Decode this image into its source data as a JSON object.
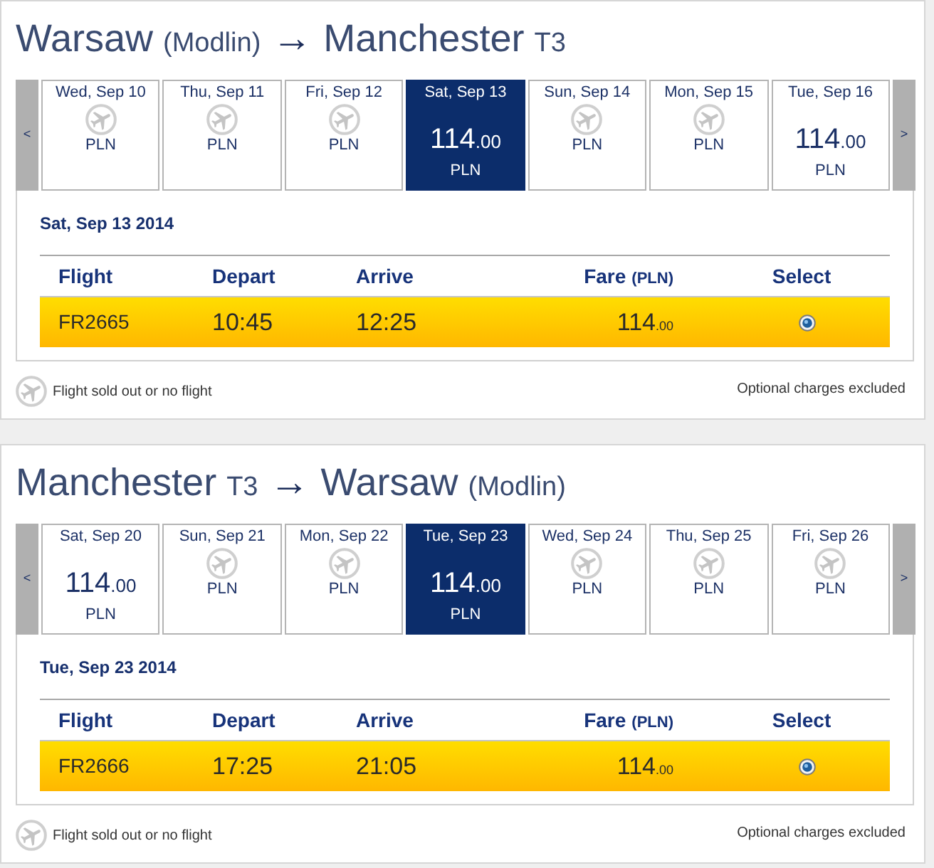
{
  "journeys": [
    {
      "title": {
        "origin": "Warsaw",
        "origin_note": "(Modlin)",
        "arrow": "→",
        "destination": "Manchester",
        "destination_note": "T3"
      },
      "prev_button": "<",
      "next_button": ">",
      "dates": [
        {
          "kind": "no_flight",
          "label": "Wed, Sep 10",
          "currency": "PLN",
          "selected": false
        },
        {
          "kind": "no_flight",
          "label": "Thu, Sep 11",
          "currency": "PLN",
          "selected": false
        },
        {
          "kind": "no_flight",
          "label": "Fri, Sep 12",
          "currency": "PLN",
          "selected": false
        },
        {
          "kind": "fare",
          "label": "Sat, Sep 13",
          "price": "114",
          "cents": ".00",
          "currency": "PLN",
          "selected": true
        },
        {
          "kind": "no_flight",
          "label": "Sun, Sep 14",
          "currency": "PLN",
          "selected": false
        },
        {
          "kind": "no_flight",
          "label": "Mon, Sep 15",
          "currency": "PLN",
          "selected": false
        },
        {
          "kind": "fare",
          "label": "Tue, Sep 16",
          "price": "114",
          "cents": ".00",
          "currency": "PLN",
          "selected": false
        }
      ],
      "selected_date": "Sat, Sep 13 2014",
      "columns": [
        {
          "label": "Flight"
        },
        {
          "label": "Depart"
        },
        {
          "label": "Arrive"
        },
        {
          "label": "Fare",
          "note": "(PLN)"
        },
        {
          "label": "Select"
        }
      ],
      "flights": [
        {
          "number": "FR2665",
          "depart": "10:45",
          "arrive": "12:25",
          "price": "114",
          "cents": ".00",
          "selected": true
        }
      ],
      "legend": "Flight sold out or no flight",
      "note": "Optional charges excluded"
    },
    {
      "title": {
        "origin": "Manchester",
        "origin_note": "T3",
        "arrow": "→",
        "destination": "Warsaw",
        "destination_note": "(Modlin)"
      },
      "prev_button": "<",
      "next_button": ">",
      "dates": [
        {
          "kind": "fare",
          "label": "Sat, Sep 20",
          "price": "114",
          "cents": ".00",
          "currency": "PLN",
          "selected": false
        },
        {
          "kind": "no_flight",
          "label": "Sun, Sep 21",
          "currency": "PLN",
          "selected": false
        },
        {
          "kind": "no_flight",
          "label": "Mon, Sep 22",
          "currency": "PLN",
          "selected": false
        },
        {
          "kind": "fare",
          "label": "Tue, Sep 23",
          "price": "114",
          "cents": ".00",
          "currency": "PLN",
          "selected": true
        },
        {
          "kind": "no_flight",
          "label": "Wed, Sep 24",
          "currency": "PLN",
          "selected": false
        },
        {
          "kind": "no_flight",
          "label": "Thu, Sep 25",
          "currency": "PLN",
          "selected": false
        },
        {
          "kind": "no_flight",
          "label": "Fri, Sep 26",
          "currency": "PLN",
          "selected": false
        }
      ],
      "selected_date": "Tue, Sep 23 2014",
      "columns": [
        {
          "label": "Flight"
        },
        {
          "label": "Depart"
        },
        {
          "label": "Arrive"
        },
        {
          "label": "Fare",
          "note": "(PLN)"
        },
        {
          "label": "Select"
        }
      ],
      "flights": [
        {
          "number": "FR2666",
          "depart": "17:25",
          "arrive": "21:05",
          "price": "114",
          "cents": ".00",
          "selected": true
        }
      ],
      "legend": "Flight sold out or no flight",
      "note": "Optional charges excluded"
    }
  ]
}
